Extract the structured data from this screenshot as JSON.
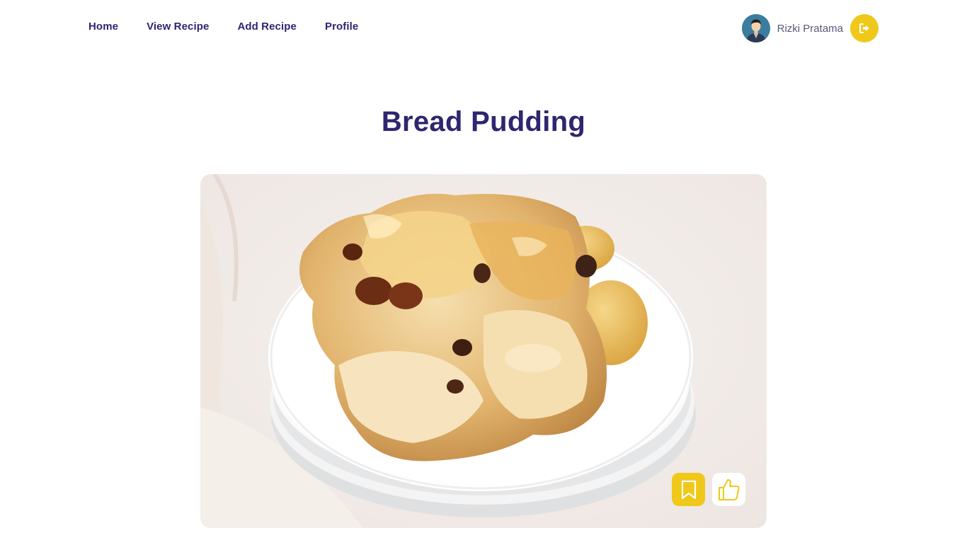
{
  "nav": {
    "items": [
      {
        "label": "Home"
      },
      {
        "label": "View Recipe"
      },
      {
        "label": "Add Recipe"
      },
      {
        "label": "Profile"
      }
    ]
  },
  "user": {
    "name": "Rizki Pratama",
    "avatar_icon": "user-avatar",
    "logout_icon": "logout-icon"
  },
  "recipe": {
    "title": "Bread Pudding",
    "image_subject": "bread-pudding-photo",
    "actions": {
      "save_icon": "bookmark-icon",
      "like_icon": "thumbs-up-icon"
    }
  },
  "colors": {
    "primary_text": "#2e266f",
    "accent": "#efc81a",
    "muted_text": "#5b5675"
  }
}
